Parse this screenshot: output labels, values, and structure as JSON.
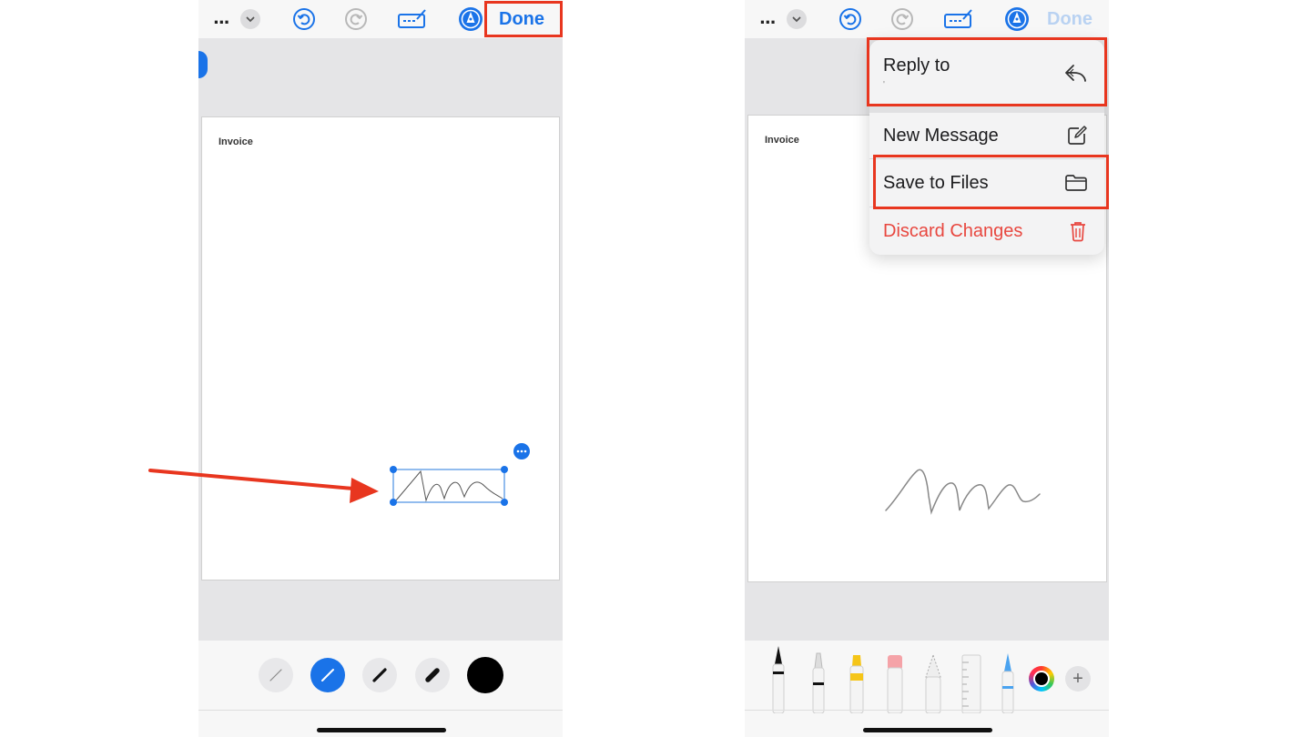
{
  "left_screen": {
    "toolbar": {
      "more_label": "...",
      "done_label": "Done"
    },
    "document": {
      "title": "Invoice"
    },
    "stroke_options": [
      "thin-pen",
      "medium-pen",
      "thick-pen",
      "marker",
      "black-color"
    ]
  },
  "right_screen": {
    "toolbar": {
      "more_label": "...",
      "done_label": "Done"
    },
    "document": {
      "title": "Invoice"
    },
    "menu": {
      "reply_label": "Reply to",
      "reply_sub": "'",
      "new_message_label": "New Message",
      "save_files_label": "Save to Files",
      "discard_label": "Discard Changes"
    },
    "tools": [
      "pen",
      "marker",
      "highlighter",
      "eraser",
      "pencil",
      "ruler",
      "fountain-pen"
    ],
    "plus_label": "+"
  },
  "colors": {
    "accent": "#1a73e8",
    "highlight_box": "#e8361f",
    "danger": "#e8473f",
    "arrow": "#e8361f"
  }
}
